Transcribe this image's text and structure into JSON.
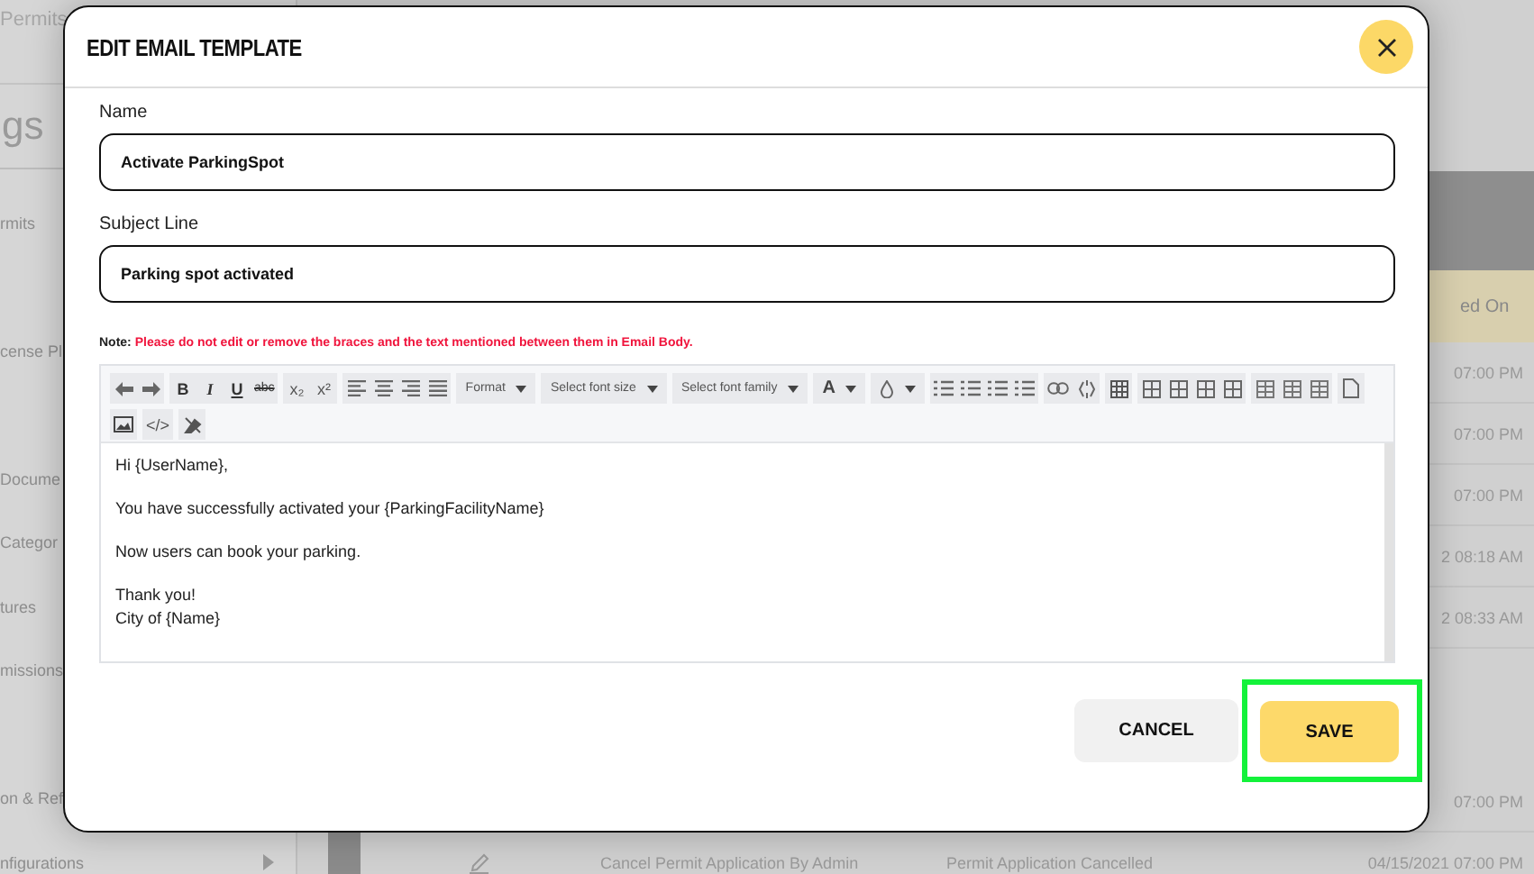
{
  "background": {
    "breadcrumb": "Permits",
    "heading": "gs",
    "sidebar": [
      {
        "label": "rmits"
      },
      {
        "label": "cense Pl"
      },
      {
        "label": "Docume"
      },
      {
        "label": "Categor"
      },
      {
        "label": "tures"
      },
      {
        "label": "missions"
      },
      {
        "label": "on & Ref"
      },
      {
        "label": "nfigurations"
      }
    ],
    "table": {
      "date_header": "ed On",
      "rows": [
        {
          "date": "07:00 PM"
        },
        {
          "date": "07:00 PM"
        },
        {
          "date": "07:00 PM"
        },
        {
          "date": "2 08:18 AM"
        },
        {
          "date": "2 08:33 AM"
        },
        {
          "date": "07:00 PM"
        },
        {
          "name": "Cancel Permit Application By Admin",
          "event": "Permit Application Cancelled",
          "date": "04/15/2021 07:00 PM"
        }
      ]
    }
  },
  "modal": {
    "title": "EDIT EMAIL TEMPLATE",
    "fields": [
      {
        "label": "Name",
        "value": "Activate ParkingSpot"
      },
      {
        "label": "Subject Line",
        "value": "Parking spot activated"
      }
    ],
    "note": {
      "label": "Note:",
      "text": "Please do not edit or remove the braces and the text mentioned between them in Email Body."
    },
    "toolbar": {
      "format_buttons": [
        "B",
        "I",
        "U",
        "abc"
      ],
      "script_buttons": [
        "x₂",
        "x²"
      ],
      "dropdowns": [
        "Format",
        "Select font size",
        "Select font family",
        "A"
      ],
      "code_button": "</>"
    },
    "body": [
      [
        "Hi {UserName},"
      ],
      [
        "You have successfully activated your {ParkingFacilityName}"
      ],
      [
        "Now users can book your parking."
      ],
      [
        "Thank you!",
        "City of {Name}"
      ]
    ],
    "buttons": {
      "cancel": "CANCEL",
      "save": "SAVE"
    },
    "highlight": {
      "on": true
    }
  }
}
